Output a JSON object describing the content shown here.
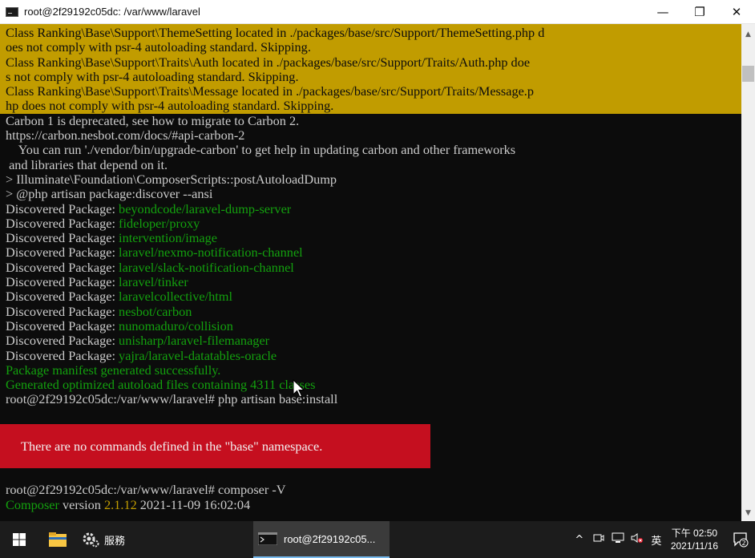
{
  "window": {
    "title": "root@2f29192c05dc: /var/www/laravel",
    "minimize": "—",
    "maximize": "❐",
    "close": "✕"
  },
  "terminal": {
    "warnings": [
      "Class Ranking\\Base\\Support\\ThemeSetting located in ./packages/base/src/Support/ThemeSetting.php d",
      "oes not comply with psr-4 autoloading standard. Skipping.",
      "Class Ranking\\Base\\Support\\Traits\\Auth located in ./packages/base/src/Support/Traits/Auth.php doe",
      "s not comply with psr-4 autoloading standard. Skipping.",
      "Class Ranking\\Base\\Support\\Traits\\Message located in ./packages/base/src/Support/Traits/Message.p",
      "hp does not comply with psr-4 autoloading standard. Skipping."
    ],
    "carbon_lines": [
      "Carbon 1 is deprecated, see how to migrate to Carbon 2.",
      "https://carbon.nesbot.com/docs/#api-carbon-2",
      "    You can run './vendor/bin/upgrade-carbon' to get help in updating carbon and other frameworks",
      " and libraries that depend on it.",
      "> Illuminate\\Foundation\\ComposerScripts::postAutoloadDump",
      "> @php artisan package:discover --ansi"
    ],
    "discovered_prefix": "Discovered Package: ",
    "packages": [
      "beyondcode/laravel-dump-server",
      "fideloper/proxy",
      "intervention/image",
      "laravel/nexmo-notification-channel",
      "laravel/slack-notification-channel",
      "laravel/tinker",
      "laravelcollective/html",
      "nesbot/carbon",
      "nunomaduro/collision",
      "unisharp/laravel-filemanager",
      "yajra/laravel-datatables-oracle"
    ],
    "manifest_line": "Package manifest generated successfully.",
    "autoload_line": "Generated optimized autoload files containing 4311 classes",
    "cmd1": "root@2f29192c05dc:/var/www/laravel# php artisan base:install",
    "error_message": "There are no commands defined in the \"base\" namespace.",
    "cmd2": "root@2f29192c05dc:/var/www/laravel# composer -V",
    "composer_word": "Composer",
    "version_label": " version ",
    "version_number": "2.1.12",
    "version_date": " 2021-11-09 16:02:04"
  },
  "scrollbar": {
    "up": "▲",
    "down": "▼"
  },
  "taskbar": {
    "services_label": "服務",
    "terminal_task_label": "root@2f29192c05...",
    "tray_caret": "^",
    "tray_lang": "英",
    "time": "下午 02:50",
    "date": "2021/11/16",
    "notification_count": "2"
  },
  "colors": {
    "warning_bg": "#c19c00",
    "error_bg": "#c50f1f",
    "green": "#13a10e",
    "yellow": "#c19c00",
    "terminal_bg": "#0c0c0c"
  }
}
